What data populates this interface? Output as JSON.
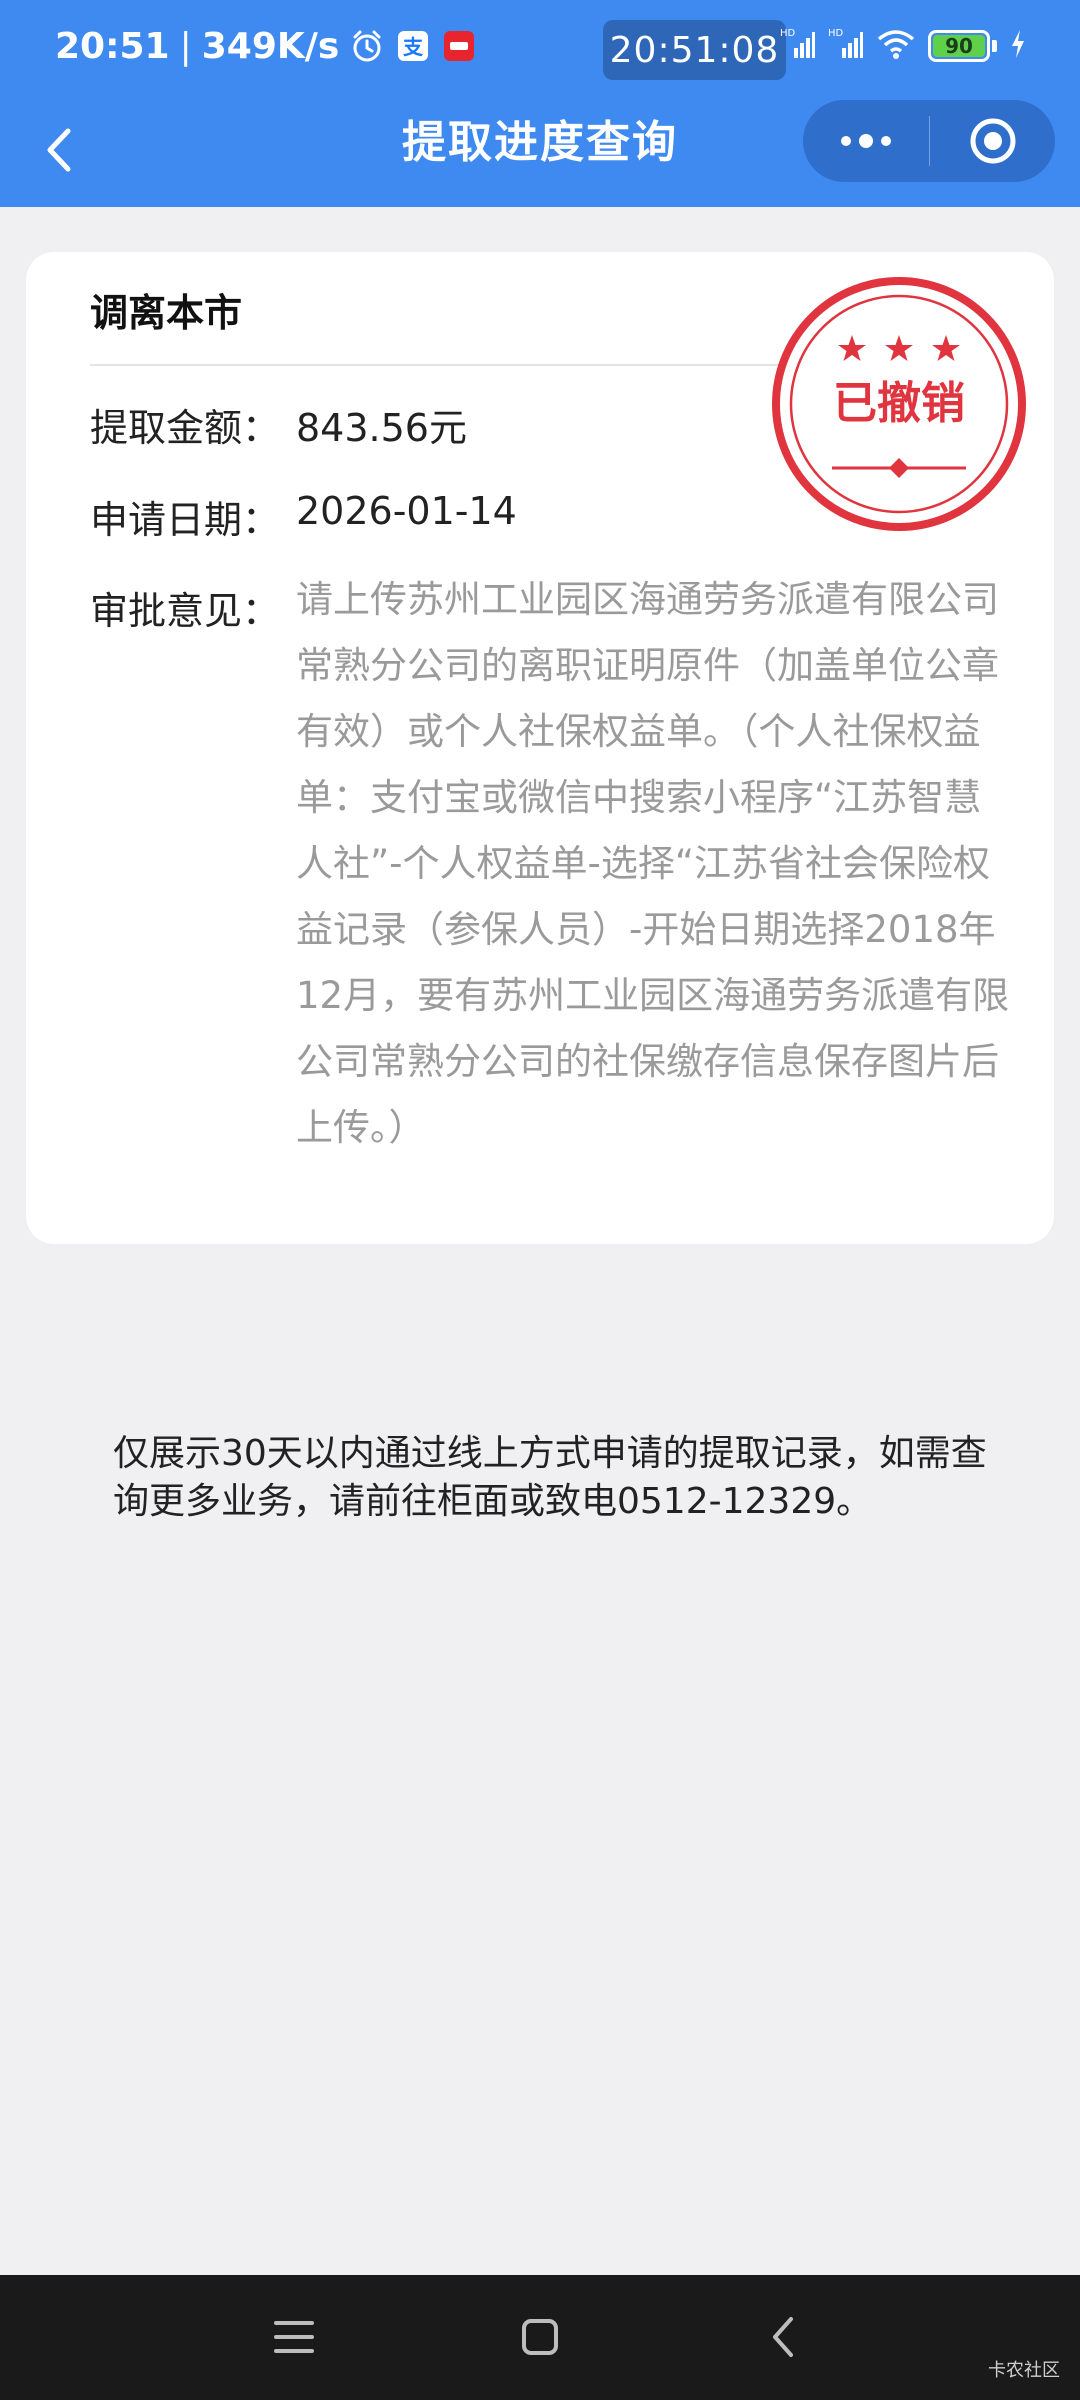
{
  "status_bar": {
    "time": "20:51",
    "speed": "349K/s",
    "clock_overlay": "20:51:08",
    "battery": "90",
    "battery_level": 0.9,
    "icons": [
      "alarm-icon",
      "alipay-icon",
      "app-badge-icon",
      "hd-signal-icon",
      "hd-signal-icon",
      "wifi-icon",
      "battery-icon",
      "charging-icon"
    ]
  },
  "nav": {
    "title": "提取进度查询",
    "back_icon": "chevron-left-icon",
    "more_icon": "more-dots-icon",
    "close_icon": "target-close-icon"
  },
  "record": {
    "title": "调离本市",
    "amount_label": "提取金额：",
    "amount_value": "843.56元",
    "date_label": "申请日期：",
    "date_value": "2026-01-14",
    "comment_label": "审批意见：",
    "comment_value": "请上传苏州工业园区海通劳务派遣有限公司常熟分公司的离职证明原件（加盖单位公章有效）或个人社保权益单。（个人社保权益单：支付宝或微信中搜索小程序“江苏智慧人社”-个人权益单-选择“江苏省社会保险权益记录（参保人员）-开始日期选择2018年12月，要有苏州工业园区海通劳务派遣有限公司常熟分公司的社保缴存信息保存图片后上传。）",
    "stamp_text": "已撤销"
  },
  "note": "仅展示30天以内通过线上方式申请的提取记录，如需查询更多业务，请前往柜面或致电0512-12329。",
  "system_nav": {
    "menu_icon": "menu-icon",
    "home_icon": "home-icon",
    "back_icon": "back-icon"
  },
  "watermark": "卡农社区",
  "colors": {
    "accent": "#3e8af0",
    "stamp": "#e0353f",
    "comment_text": "#9a9a9a"
  }
}
